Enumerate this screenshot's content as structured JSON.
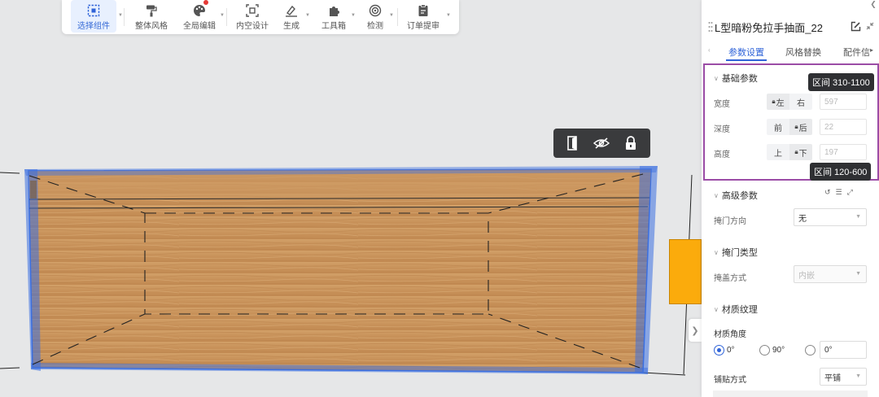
{
  "toolbar": {
    "items": [
      {
        "label": "选择组件",
        "icon": "select-component-icon",
        "active": true
      },
      {
        "label": "整体风格",
        "icon": "paint-roller-icon"
      },
      {
        "label": "全局编辑",
        "icon": "palette-icon",
        "badge": true
      },
      {
        "label": "内空设计",
        "icon": "inner-space-icon"
      },
      {
        "label": "生成",
        "icon": "generate-icon"
      },
      {
        "label": "工具箱",
        "icon": "puzzle-icon"
      },
      {
        "label": "检测",
        "icon": "detect-icon"
      },
      {
        "label": "订单提审",
        "icon": "order-review-icon"
      }
    ]
  },
  "float_toolbar": {
    "icons": [
      "door-icon",
      "hide-icon",
      "lock-icon"
    ]
  },
  "panel": {
    "title": "L型暗粉免拉手抽面_22",
    "tabs": [
      "参数设置",
      "风格替换",
      "配件信"
    ],
    "active_tab": "参数设置",
    "basic": {
      "title": "基础参数",
      "width": {
        "label": "宽度",
        "opt1": "左",
        "opt2": "右",
        "value": "597",
        "locked": "opt1"
      },
      "depth": {
        "label": "深度",
        "opt1": "前",
        "opt2": "后",
        "value": "22",
        "locked": "opt2"
      },
      "height": {
        "label": "高度",
        "opt1": "上",
        "opt2": "下",
        "value": "197",
        "locked": "opt2"
      },
      "tooltip_top": "区间 310-1100",
      "tooltip_bottom": "区间 120-600"
    },
    "advanced": {
      "title": "高级参数",
      "door_dir_label": "掩门方向",
      "door_dir_value": "无"
    },
    "door_type": {
      "title": "掩门类型",
      "cover_label": "掩盖方式",
      "cover_value": "内嵌"
    },
    "texture": {
      "title": "材质纹理",
      "angle_label": "材质角度",
      "options": [
        "0°",
        "90°"
      ],
      "selected": "0°",
      "custom_angle": "0°",
      "paste_label": "铺贴方式",
      "paste_value": "平铺"
    }
  },
  "colors": {
    "accent": "#2f63d8",
    "highlight_box": "#9b4ca6",
    "wood": "#c8955a",
    "selection": "#3b6fe0",
    "orange_block": "#fbab0c"
  }
}
